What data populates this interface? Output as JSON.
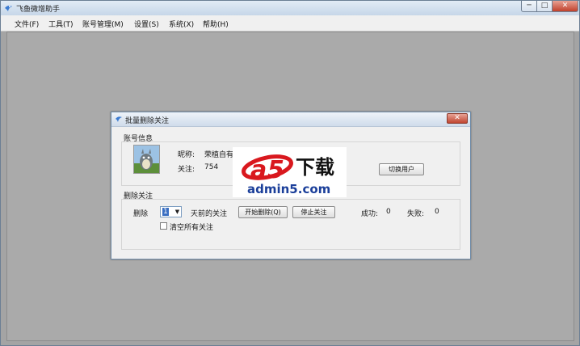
{
  "app": {
    "title": "飞鱼微增助手",
    "window_controls": {
      "minimize": "─",
      "maximize": "□",
      "close": "✕"
    }
  },
  "menubar": {
    "items": [
      {
        "label": "文件(F)"
      },
      {
        "label": "工具(T)"
      },
      {
        "label": "账号管理(M)"
      },
      {
        "label": "设置(S)"
      },
      {
        "label": "系统(X)"
      },
      {
        "label": "帮助(H)"
      }
    ]
  },
  "dialog": {
    "title": "批量删除关注",
    "close": "✕",
    "account_info": {
      "group_label": "账号信息",
      "nickname_label": "昵称:",
      "nickname_value": "荣植自有",
      "follow_label": "关注:",
      "follow_value": "754",
      "switch_user_button": "切换用户"
    },
    "delete_follow": {
      "group_label": "删除关注",
      "delete_label": "删除",
      "days_value": "1",
      "days_suffix": "天前的关注",
      "start_button": "开始删除(Q)",
      "stop_button": "停止关注",
      "success_label": "成功:",
      "success_value": "0",
      "fail_label": "失败:",
      "fail_value": "0",
      "clear_all_label": "清空所有关注",
      "clear_all_checked": false
    }
  },
  "watermark": {
    "logo_a": "a",
    "logo_5": "5",
    "logo_text": "下载",
    "url": "admin5.com",
    "colors": {
      "red": "#d9181e",
      "blue": "#1b3f9a"
    }
  }
}
